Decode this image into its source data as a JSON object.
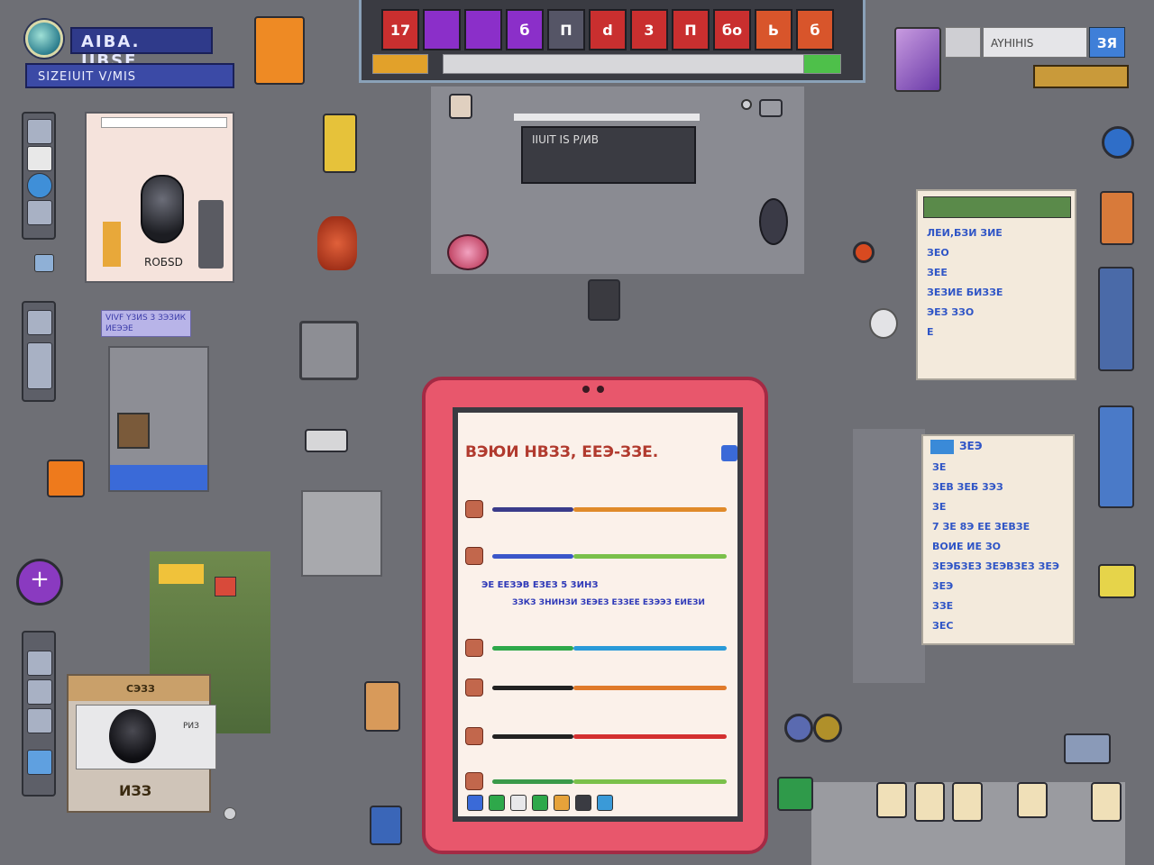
{
  "brand": {
    "title": "AIBA. IIBSF",
    "subtitle": "SIZEIUIT V/MIS"
  },
  "tabs": [
    {
      "label": "17",
      "color": "#c92f2f"
    },
    {
      "label": "",
      "color": "#8b2fc9"
    },
    {
      "label": "",
      "color": "#8b2fc9"
    },
    {
      "label": "б",
      "color": "#8b2fc9"
    },
    {
      "label": "П",
      "color": "#555566"
    },
    {
      "label": "d",
      "color": "#c92f2f"
    },
    {
      "label": "3",
      "color": "#c92f2f"
    },
    {
      "label": "П",
      "color": "#c92f2f"
    },
    {
      "label": "бо",
      "color": "#c92f2f"
    },
    {
      "label": "Ь",
      "color": "#d8552b"
    },
    {
      "label": "б",
      "color": "#d8552b"
    }
  ],
  "top_right": {
    "label": "AYHIHIS",
    "badge": "ЗЯ"
  },
  "center_window": {
    "label": "IIUIT IS  Р/ИВ"
  },
  "mouse_panel": {
    "caption": "ROБSD"
  },
  "left_note": {
    "label": "VIVF Y3ИS 3 ЗЭЗИК ИЕЭЭЕ"
  },
  "tablet": {
    "heading": "ВЭЮИ НВЗЗ, ЕЕЭ-ЗЗЕ.",
    "rows": [
      {
        "bar_color": "#3a3b8a",
        "accent": "#e08a2a"
      },
      {
        "bar_color": "#3a56c9",
        "accent": "#7ac04a"
      },
      {
        "bar_color": "#2ea84a",
        "accent": "#2a9ad8"
      },
      {
        "bar_color": "#222222",
        "accent": "#e07a2a"
      },
      {
        "bar_color": "#222222",
        "accent": "#d43030"
      },
      {
        "bar_color": "#3a9a4a",
        "accent": "#7ac04a"
      }
    ],
    "text_block_1": "ЭЕ ЕЕЗЭВ ЕЗЕЗ 5 3ИНЗ",
    "text_block_2": "ЗЗКЗ ЗНИНЗИ ЗЕЭЕЗ ЕЗЗЕЕ ЕЗЭЭЗ ЕИЕЗИ"
  },
  "right_panel_1": {
    "lines": [
      "ЛЕИ,БЗИ ЗИЕ",
      "ЗЕО",
      "ЗЕЕ",
      "ЗЕЗИЕ БИЗЗЕ",
      "ЭЕЗ ЗЗО",
      "Е"
    ]
  },
  "right_panel_2": {
    "header": "ЗЕЭ",
    "lines": [
      "ЗЕ",
      "ЗЕВ ЗЕБ 3ЭЗ",
      "ЗЕ",
      "7 ЗЕ 8Э  ЕЕ ЗЕВЗЕ",
      "ВОИЕ ИЕ ЗО",
      "ЗЕЭБЗЕЗ ЗЕЭВЗЕЗ ЗЕЭ",
      "3ЕЭ",
      "ЗЗЕ",
      "ЗЕС"
    ]
  },
  "photo_panel": {
    "label": "СЭЗЗ",
    "caption": "ИЗЗ",
    "icon_label": "РИЗ"
  }
}
